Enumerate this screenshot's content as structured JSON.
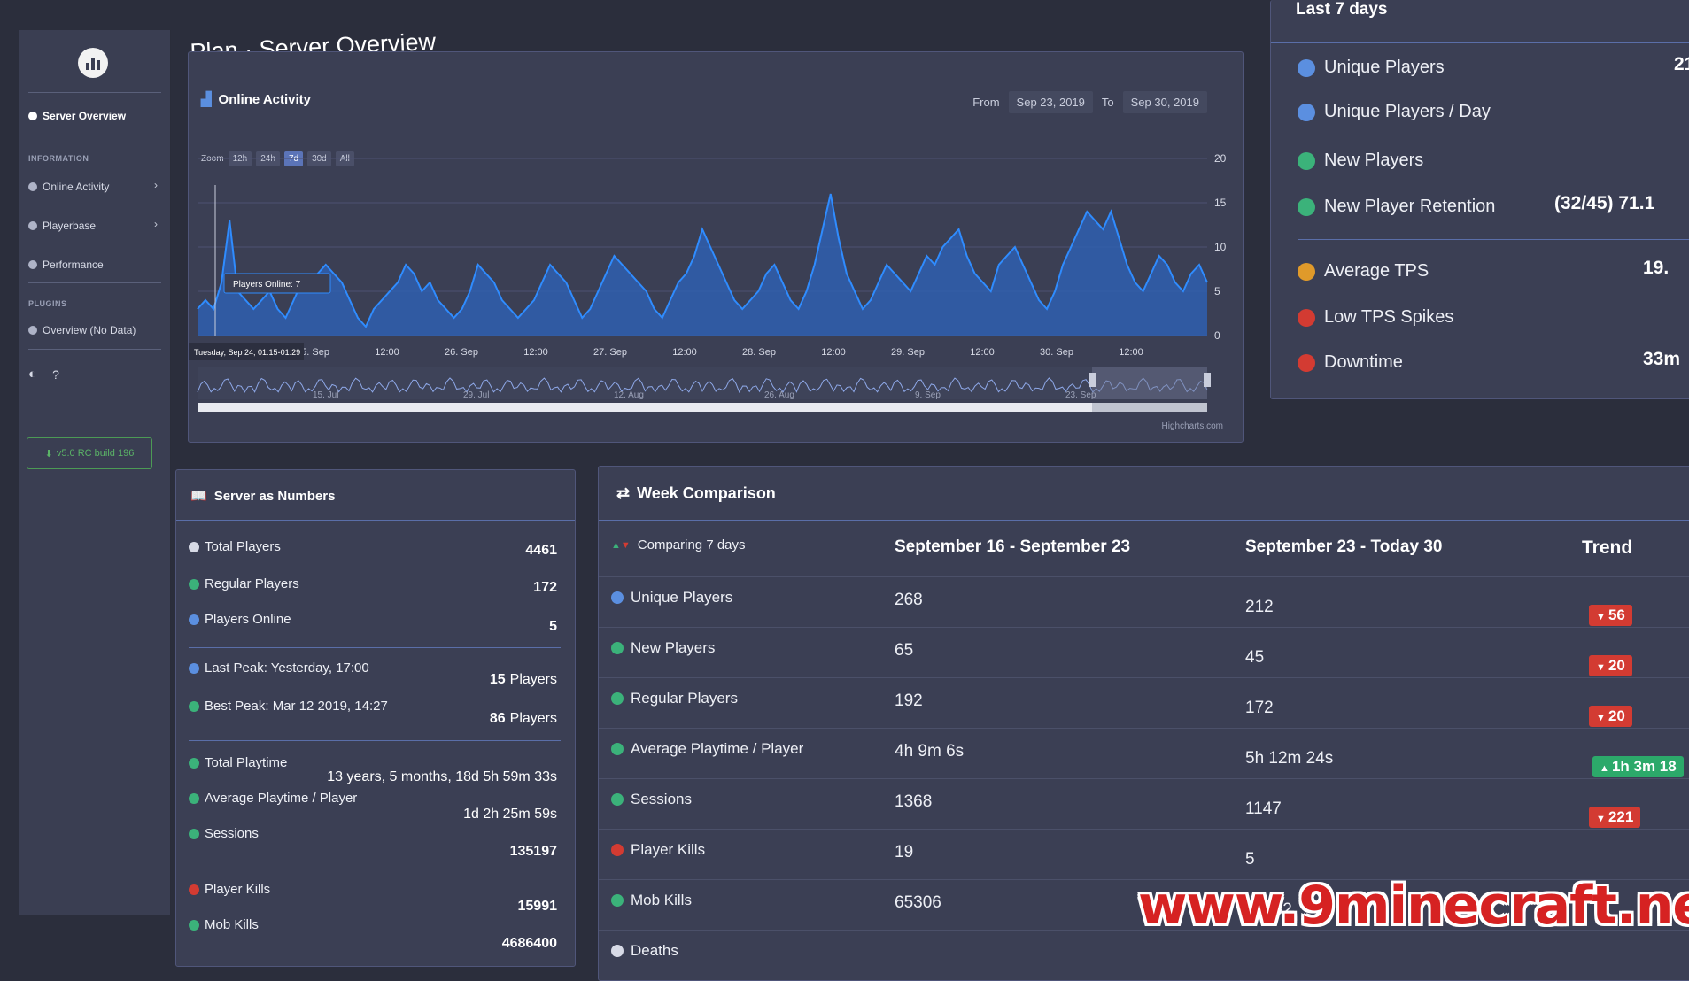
{
  "app": {
    "title": "Plan · Server Overview"
  },
  "sidebar": {
    "active": "Server Overview",
    "section_information": "INFORMATION",
    "items": [
      {
        "label": "Online Activity",
        "icon": "chart-area-icon"
      },
      {
        "label": "Playerbase",
        "icon": "users-icon"
      },
      {
        "label": "Performance",
        "icon": "cogs-icon"
      }
    ],
    "section_plugins": "PLUGINS",
    "plugins_item": "Overview (No Data)",
    "version": "v5.0 RC build 196"
  },
  "activity": {
    "title": "Online Activity",
    "zoom_label": "Zoom",
    "zoom_buttons": [
      "12h",
      "24h",
      "7d",
      "30d",
      "All"
    ],
    "zoom_selected": "7d",
    "from_label": "From",
    "from_date": "Sep 23, 2019",
    "to_label": "To",
    "to_date": "Sep 30, 2019",
    "tooltip_header": "Tuesday, Sep 24, 01:15-01:29",
    "tooltip_text": "Players Online: 7",
    "credit": "Highcharts.com",
    "navigator_labels": [
      "15. Jul",
      "29. Jul",
      "12. Aug",
      "26. Aug",
      "9. Sep",
      "23. Sep"
    ]
  },
  "chart_data": {
    "type": "area",
    "title": "",
    "xlabel": "",
    "ylabel": "",
    "x_tick_labels": [
      "25. Sep",
      "12:00",
      "26. Sep",
      "12:00",
      "27. Sep",
      "12:00",
      "28. Sep",
      "12:00",
      "29. Sep",
      "12:00",
      "30. Sep",
      "12:00"
    ],
    "y_ticks": [
      0,
      5,
      10,
      15,
      20
    ],
    "ylim": [
      0,
      20
    ],
    "series": [
      {
        "values": [
          3,
          4,
          3,
          6,
          13,
          5,
          4,
          3,
          4,
          5,
          3,
          2,
          4,
          6,
          5,
          7,
          8,
          7,
          6,
          4,
          2,
          1,
          3,
          4,
          5,
          6,
          8,
          7,
          5,
          6,
          4,
          3,
          2,
          3,
          5,
          8,
          7,
          6,
          4,
          3,
          2,
          3,
          4,
          6,
          8,
          7,
          6,
          4,
          2,
          3,
          5,
          7,
          9,
          8,
          7,
          6,
          5,
          3,
          2,
          4,
          6,
          7,
          9,
          12,
          10,
          8,
          6,
          4,
          3,
          4,
          5,
          7,
          8,
          6,
          4,
          3,
          5,
          8,
          12,
          16,
          11,
          7,
          5,
          3,
          4,
          6,
          8,
          7,
          6,
          5,
          7,
          9,
          8,
          10,
          11,
          12,
          9,
          7,
          6,
          5,
          8,
          9,
          10,
          8,
          6,
          4,
          3,
          5,
          8,
          10,
          12,
          14,
          13,
          12,
          14,
          11,
          8,
          6,
          5,
          7,
          9,
          8,
          6,
          5,
          7,
          8,
          6
        ]
      }
    ]
  },
  "last7": {
    "title": "Last 7 days",
    "rows": [
      {
        "label": "Unique Players",
        "value": "21",
        "icon": "users-icon",
        "color": "#5b8fe0"
      },
      {
        "label": "Unique Players / Day",
        "value": "",
        "icon": "user-icon",
        "color": "#5b8fe0"
      },
      {
        "label": "New Players",
        "value": "",
        "icon": "users-icon",
        "color": "#3bb27a"
      },
      {
        "label": "New Player Retention",
        "value": "(32/45) 71.1",
        "icon": "user-circle-icon",
        "color": "#3bb27a"
      },
      {
        "label": "Average TPS",
        "value": "19.",
        "icon": "gauge-icon",
        "color": "#e09a2a"
      },
      {
        "label": "Low TPS Spikes",
        "value": "",
        "icon": "exclamation-icon",
        "color": "#d33b32"
      },
      {
        "label": "Downtime",
        "value": "33m",
        "icon": "power-icon",
        "color": "#d33b32"
      }
    ]
  },
  "numbers": {
    "title": "Server as Numbers",
    "rows": [
      {
        "label": "Total Players",
        "value": "4461",
        "unit": ""
      },
      {
        "label": "Regular Players",
        "value": "172",
        "unit": ""
      },
      {
        "label": "Players Online",
        "value": "5",
        "unit": ""
      },
      {
        "label": "Last Peak: Yesterday, 17:00",
        "value": "15",
        "unit": "Players"
      },
      {
        "label": "Best Peak: Mar 12 2019, 14:27",
        "value": "86",
        "unit": "Players"
      },
      {
        "label": "Total Playtime",
        "value": "13 years, 5 months, 18d 5h 59m 33s",
        "unit": ""
      },
      {
        "label": "Average Playtime / Player",
        "value": "1d 2h 25m 59s",
        "unit": ""
      },
      {
        "label": "Sessions",
        "value": "135197",
        "unit": ""
      },
      {
        "label": "Player Kills",
        "value": "15991",
        "unit": ""
      },
      {
        "label": "Mob Kills",
        "value": "4686400",
        "unit": ""
      }
    ]
  },
  "week": {
    "title": "Week Comparison",
    "header_label": "Comparing 7 days",
    "col1": "September 16 - September 23",
    "col2": "September 23 - Today 30",
    "col3": "Trend",
    "rows": [
      {
        "label": "Unique Players",
        "a": "268",
        "b": "212",
        "trend": "56",
        "dir": "down"
      },
      {
        "label": "New Players",
        "a": "65",
        "b": "45",
        "trend": "20",
        "dir": "down"
      },
      {
        "label": "Regular Players",
        "a": "192",
        "b": "172",
        "trend": "20",
        "dir": "down"
      },
      {
        "label": "Average Playtime / Player",
        "a": "4h 9m 6s",
        "b": "5h 12m 24s",
        "trend": "1h 3m 18",
        "dir": "up"
      },
      {
        "label": "Sessions",
        "a": "1368",
        "b": "1147",
        "trend": "221",
        "dir": "down"
      },
      {
        "label": "Player Kills",
        "a": "19",
        "b": "5",
        "trend": "",
        "dir": "down"
      },
      {
        "label": "Mob Kills",
        "a": "65306",
        "b": "29582",
        "trend": "",
        "dir": "down"
      },
      {
        "label": "Deaths",
        "a": "",
        "b": "",
        "trend": "",
        "dir": "down"
      }
    ]
  },
  "watermark": "www.9minecraft.net"
}
